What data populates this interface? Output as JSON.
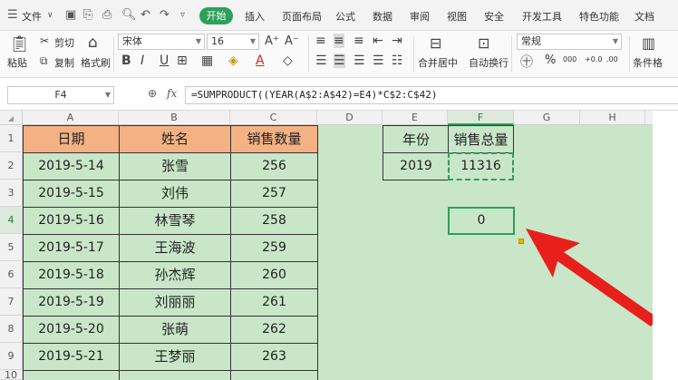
{
  "ribbon": {
    "menu_label": "文件",
    "tabs": [
      "插入",
      "页面布局",
      "公式",
      "数据",
      "审阅",
      "视图",
      "安全",
      "开发工具",
      "特色功能",
      "文档"
    ],
    "active_tab": "开始"
  },
  "toolbar": {
    "paste": "粘贴",
    "cut": "剪切",
    "copy": "复制",
    "format_painter": "格式刷",
    "font_name": "宋体",
    "font_size": "16",
    "merge_center": "合并居中",
    "wrap_text": "自动换行",
    "number_format": "常规",
    "percent": "%",
    "thousands": "000",
    "inc_decimal": "+0.0",
    "dec_decimal": ".00",
    "conditional_format": "条件格"
  },
  "formula_bar": {
    "cell_ref": "F4",
    "formula": "=SUMPRODUCT((YEAR(A$2:A$42)=E4)*C$2:C$42)"
  },
  "columns": [
    "A",
    "B",
    "C",
    "D",
    "E",
    "F",
    "G",
    "H"
  ],
  "rows": [
    "1",
    "2",
    "3",
    "4",
    "5",
    "6",
    "7",
    "8",
    "9",
    "10"
  ],
  "table": {
    "headers": [
      "日期",
      "姓名",
      "销售数量"
    ],
    "data": [
      [
        "2019-5-14",
        "张雪",
        "256"
      ],
      [
        "2019-5-15",
        "刘伟",
        "257"
      ],
      [
        "2019-5-16",
        "林雪琴",
        "258"
      ],
      [
        "2019-5-17",
        "王海波",
        "259"
      ],
      [
        "2019-5-18",
        "孙杰辉",
        "260"
      ],
      [
        "2019-5-19",
        "刘丽丽",
        "261"
      ],
      [
        "2019-5-20",
        "张萌",
        "262"
      ],
      [
        "2019-5-21",
        "王梦丽",
        "263"
      ]
    ]
  },
  "summary": {
    "year_header": "年份",
    "total_header": "销售总量",
    "year_value": "2019",
    "total_value": "11316",
    "f4_value": "0"
  },
  "colors": {
    "header_fill": "#f4b183",
    "sheet_bg": "#c9e6c9",
    "accent_green": "#2e9f5b",
    "arrow_red": "#e8201c"
  }
}
